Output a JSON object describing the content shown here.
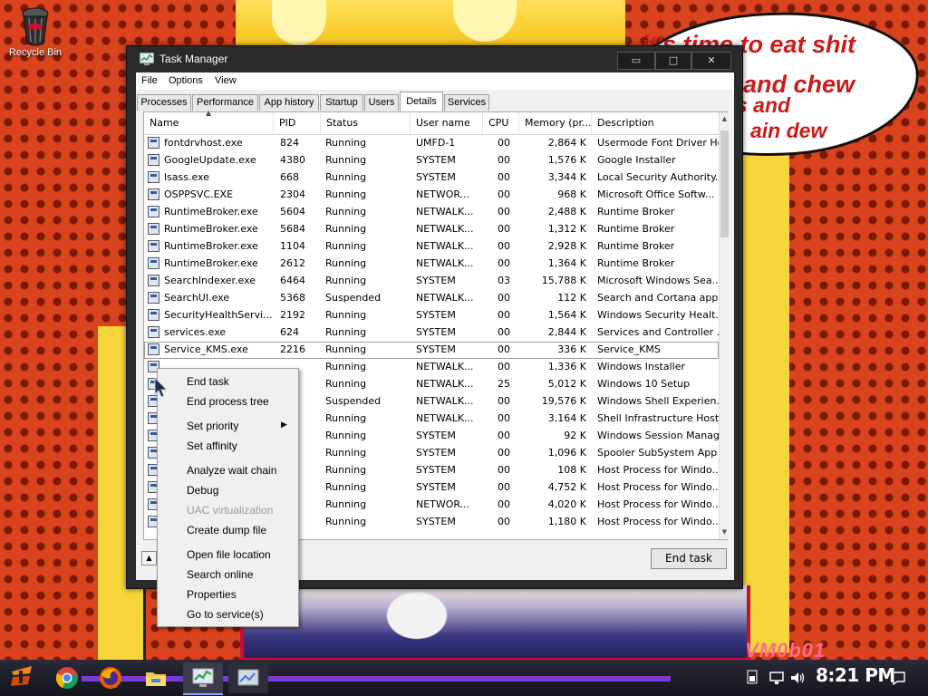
{
  "desktop": {
    "recycle_bin_label": "Recycle Bin",
    "wallpaper": {
      "bubble_line1": "it's time to eat shit",
      "bubble_line2": "and chew",
      "bubble_line3": "s and",
      "bubble_line4": "ain dew",
      "watermark": "VM0b01"
    }
  },
  "window": {
    "title": "Task Manager",
    "controls": {
      "minimize": "▭",
      "maximize": "□",
      "close": "✕"
    }
  },
  "menu": {
    "file": "File",
    "options": "Options",
    "view": "View"
  },
  "tabs": [
    {
      "label": "Processes",
      "active": false
    },
    {
      "label": "Performance",
      "active": false
    },
    {
      "label": "App history",
      "active": false
    },
    {
      "label": "Startup",
      "active": false
    },
    {
      "label": "Users",
      "active": false
    },
    {
      "label": "Details",
      "active": true
    },
    {
      "label": "Services",
      "active": false
    }
  ],
  "columns": {
    "name": "Name",
    "pid": "PID",
    "status": "Status",
    "user": "User name",
    "cpu": "CPU",
    "memory": "Memory (pr...",
    "description": "Description"
  },
  "rows": [
    {
      "name": "fontdrvhost.exe",
      "pid": "824",
      "status": "Running",
      "user": "UMFD-1",
      "cpu": "00",
      "mem": "2,864 K",
      "desc": "Usermode Font Driver Host"
    },
    {
      "name": "GoogleUpdate.exe",
      "pid": "4380",
      "status": "Running",
      "user": "SYSTEM",
      "cpu": "00",
      "mem": "1,576 K",
      "desc": "Google Installer"
    },
    {
      "name": "lsass.exe",
      "pid": "668",
      "status": "Running",
      "user": "SYSTEM",
      "cpu": "00",
      "mem": "3,344 K",
      "desc": "Local Security Authority..."
    },
    {
      "name": "OSPPSVC.EXE",
      "pid": "2304",
      "status": "Running",
      "user": "NETWOR...",
      "cpu": "00",
      "mem": "968 K",
      "desc": "Microsoft Office Softw..."
    },
    {
      "name": "RuntimeBroker.exe",
      "pid": "5604",
      "status": "Running",
      "user": "NETWALK...",
      "cpu": "00",
      "mem": "2,488 K",
      "desc": "Runtime Broker"
    },
    {
      "name": "RuntimeBroker.exe",
      "pid": "5684",
      "status": "Running",
      "user": "NETWALK...",
      "cpu": "00",
      "mem": "1,312 K",
      "desc": "Runtime Broker"
    },
    {
      "name": "RuntimeBroker.exe",
      "pid": "1104",
      "status": "Running",
      "user": "NETWALK...",
      "cpu": "00",
      "mem": "2,928 K",
      "desc": "Runtime Broker"
    },
    {
      "name": "RuntimeBroker.exe",
      "pid": "2612",
      "status": "Running",
      "user": "NETWALK...",
      "cpu": "00",
      "mem": "1,364 K",
      "desc": "Runtime Broker"
    },
    {
      "name": "SearchIndexer.exe",
      "pid": "6464",
      "status": "Running",
      "user": "SYSTEM",
      "cpu": "03",
      "mem": "15,788 K",
      "desc": "Microsoft Windows Sea..."
    },
    {
      "name": "SearchUI.exe",
      "pid": "5368",
      "status": "Suspended",
      "user": "NETWALK...",
      "cpu": "00",
      "mem": "112 K",
      "desc": "Search and Cortana appli..."
    },
    {
      "name": "SecurityHealthServi...",
      "pid": "2192",
      "status": "Running",
      "user": "SYSTEM",
      "cpu": "00",
      "mem": "1,564 K",
      "desc": "Windows Security Healt..."
    },
    {
      "name": "services.exe",
      "pid": "624",
      "status": "Running",
      "user": "SYSTEM",
      "cpu": "00",
      "mem": "2,844 K",
      "desc": "Services and Controller ..."
    },
    {
      "name": "Service_KMS.exe",
      "pid": "2216",
      "status": "Running",
      "user": "SYSTEM",
      "cpu": "00",
      "mem": "336 K",
      "desc": "Service_KMS"
    },
    {
      "name": "",
      "pid": "",
      "status": "Running",
      "user": "NETWALK...",
      "cpu": "00",
      "mem": "1,336 K",
      "desc": "Windows Installer"
    },
    {
      "name": "",
      "pid": "",
      "status": "Running",
      "user": "NETWALK...",
      "cpu": "25",
      "mem": "5,012 K",
      "desc": "Windows 10 Setup"
    },
    {
      "name": "S",
      "pid": "",
      "status": "Suspended",
      "user": "NETWALK...",
      "cpu": "00",
      "mem": "19,576 K",
      "desc": "Windows Shell Experien..."
    },
    {
      "name": "S",
      "pid": "",
      "status": "Running",
      "user": "NETWALK...",
      "cpu": "00",
      "mem": "3,164 K",
      "desc": "Shell Infrastructure Host"
    },
    {
      "name": "s",
      "pid": "",
      "status": "Running",
      "user": "SYSTEM",
      "cpu": "00",
      "mem": "92 K",
      "desc": "Windows Session Manager"
    },
    {
      "name": "s",
      "pid": "",
      "status": "Running",
      "user": "SYSTEM",
      "cpu": "00",
      "mem": "1,096 K",
      "desc": "Spooler SubSystem App"
    },
    {
      "name": "s",
      "pid": "",
      "status": "Running",
      "user": "SYSTEM",
      "cpu": "00",
      "mem": "108 K",
      "desc": "Host Process for Windo..."
    },
    {
      "name": "s",
      "pid": "",
      "status": "Running",
      "user": "SYSTEM",
      "cpu": "00",
      "mem": "4,752 K",
      "desc": "Host Process for Windo..."
    },
    {
      "name": "s",
      "pid": "",
      "status": "Running",
      "user": "NETWOR...",
      "cpu": "00",
      "mem": "4,020 K",
      "desc": "Host Process for Windo..."
    },
    {
      "name": "s",
      "pid": "",
      "status": "Running",
      "user": "SYSTEM",
      "cpu": "00",
      "mem": "1,180 K",
      "desc": "Host Process for Windo..."
    }
  ],
  "selected_row": 12,
  "footer": {
    "fewer_details_icon": "chevron-up-icon",
    "end_task": "End task"
  },
  "context_menu": {
    "items": [
      {
        "label": "End task",
        "disabled": false
      },
      {
        "label": "End process tree",
        "disabled": false
      },
      {
        "label": "Set priority",
        "disabled": false,
        "submenu": true
      },
      {
        "label": "Set affinity",
        "disabled": false
      },
      {
        "label": "Analyze wait chain",
        "disabled": false
      },
      {
        "label": "Debug",
        "disabled": false
      },
      {
        "label": "UAC virtualization",
        "disabled": true
      },
      {
        "label": "Create dump file",
        "disabled": false
      },
      {
        "label": "Open file location",
        "disabled": false
      },
      {
        "label": "Search online",
        "disabled": false
      },
      {
        "label": "Properties",
        "disabled": false
      },
      {
        "label": "Go to service(s)",
        "disabled": false
      }
    ]
  },
  "taskbar": {
    "clock": "8:21 PM",
    "pinned": [
      "chrome-icon",
      "firefox-icon",
      "file-explorer-icon",
      "task-manager-icon",
      "app-window-icon"
    ],
    "accent": "#7d3bd6"
  }
}
